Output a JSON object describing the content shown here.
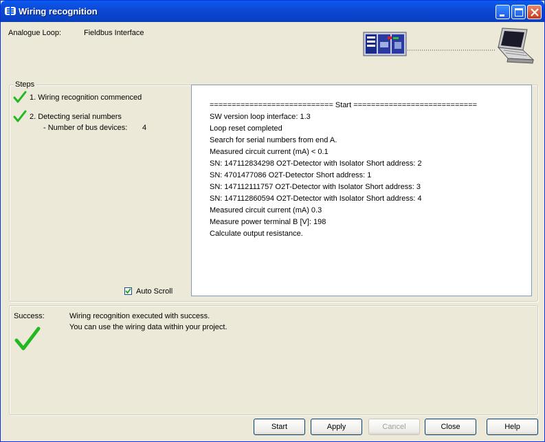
{
  "window": {
    "title": "Wiring recognition"
  },
  "header": {
    "loop_label": "Analogue Loop:",
    "interface_label": "Fieldbus Interface"
  },
  "steps": {
    "group_title": "Steps",
    "items": [
      {
        "label": "1. Wiring recognition commenced"
      },
      {
        "label": "2. Detecting serial numbers"
      }
    ],
    "bus_devices_label": "- Number of bus devices:",
    "bus_devices_value": "4"
  },
  "log": {
    "lines": [
      "============================ Start ============================",
      "SW version loop interface: 1.3",
      "Loop reset completed",
      "Search for serial numbers from end A.",
      "Measured circuit current (mA)  < 0.1",
      "SN: 147112834298  O2T-Detector  with Isolator Short address: 2",
      "SN: 4701477086  O2T-Detector    Short address: 1",
      "SN: 147112111757  O2T-Detector  with Isolator Short address: 3",
      "SN: 147112860594  O2T-Detector  with Isolator Short address: 4",
      "Measured circuit current (mA)  0.3",
      "Measure power terminal B [V]: 198",
      "Calculate output resistance."
    ]
  },
  "auto_scroll": {
    "label": "Auto Scroll",
    "checked": true
  },
  "result": {
    "status_label": "Success:",
    "message_line1": "Wiring recognition executed with success.",
    "message_line2": "You can use the wiring data within your project."
  },
  "buttons": {
    "start": "Start",
    "apply": "Apply",
    "cancel": "Cancel",
    "close": "Close",
    "help": "Help"
  },
  "colors": {
    "check_green": "#22b822",
    "title_blue": "#0a5cf0"
  },
  "icons": [
    "app-icon",
    "minimize-icon",
    "maximize-icon",
    "close-icon",
    "fire-panel-icon",
    "laptop-icon",
    "checkmark-icon"
  ]
}
